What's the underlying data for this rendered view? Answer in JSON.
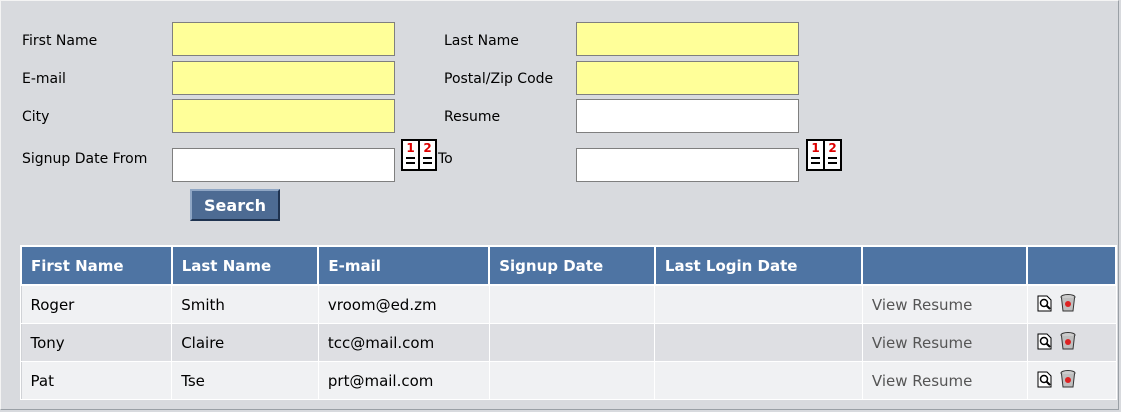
{
  "form": {
    "first_name_label": "First Name",
    "email_label": "E-mail",
    "city_label": "City",
    "signup_from_label": "Signup Date From",
    "last_name_label": "Last Name",
    "postal_label": "Postal/Zip Code",
    "resume_label": "Resume",
    "to_label": "To",
    "first_name_value": "",
    "email_value": "",
    "city_value": "",
    "signup_from_value": "",
    "last_name_value": "",
    "postal_value": "",
    "resume_value": "",
    "signup_to_value": "",
    "calendar_icon_text": [
      "1",
      "2"
    ],
    "search_label": "Search",
    "required_field_color": "#ffff99"
  },
  "table": {
    "headers": [
      "First Name",
      "Last Name",
      "E-mail",
      "Signup Date",
      "Last Login Date",
      "",
      ""
    ],
    "header_color": "#4e74a3",
    "rows": [
      {
        "first": "Roger",
        "last": "Smith",
        "email": "vroom@ed.zm",
        "signup": "",
        "login": "",
        "link": "View Resume"
      },
      {
        "first": "Tony",
        "last": "Claire",
        "email": "tcc@mail.com",
        "signup": "",
        "login": "",
        "link": "View Resume"
      },
      {
        "first": "Pat",
        "last": "Tse",
        "email": "prt@mail.com",
        "signup": "",
        "login": "",
        "link": "View Resume"
      }
    ],
    "row_icons": [
      "view-icon",
      "delete-icon"
    ]
  }
}
